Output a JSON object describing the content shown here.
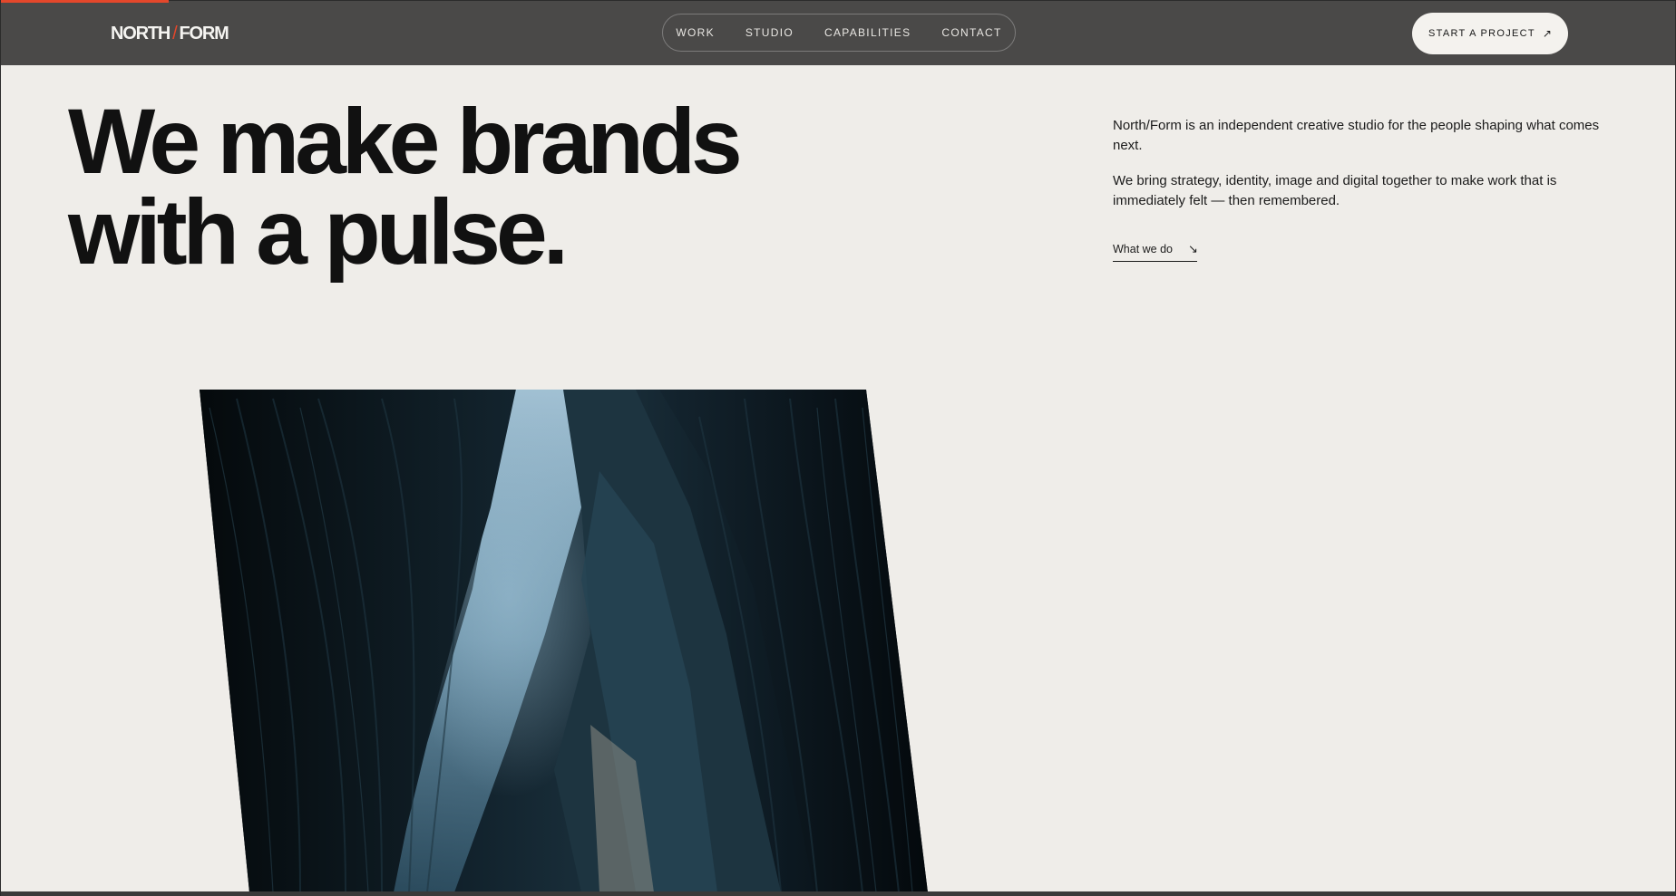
{
  "colors": {
    "header_bg": "#4a4948",
    "page_bg": "#efede9",
    "accent": "#e4472b",
    "text_dark": "#111111",
    "button_bg": "#f4f2ee"
  },
  "scroll_progress": 0.1,
  "header": {
    "logo": {
      "left": "NORTH",
      "slash": "/",
      "right": "FORM"
    },
    "nav": [
      {
        "label": "WORK"
      },
      {
        "label": "STUDIO"
      },
      {
        "label": "CAPABILITIES"
      },
      {
        "label": "CONTACT"
      }
    ],
    "cta": {
      "label": "START A PROJECT",
      "icon": "arrow-up-right-icon",
      "glyph": "↗"
    }
  },
  "hero": {
    "headline_line1": "We make brands",
    "headline_line2": "with a pulse.",
    "intro_p1": "North/Form is an independent creative studio for the people shaping what comes next.",
    "intro_p2": "We bring strategy, identity, image and digital together to make work that is immediately felt — then remembered.",
    "link": {
      "label": "What we do",
      "icon": "arrow-down-right-icon",
      "glyph": "↘"
    },
    "image": {
      "subject": "canyon-photo"
    }
  }
}
